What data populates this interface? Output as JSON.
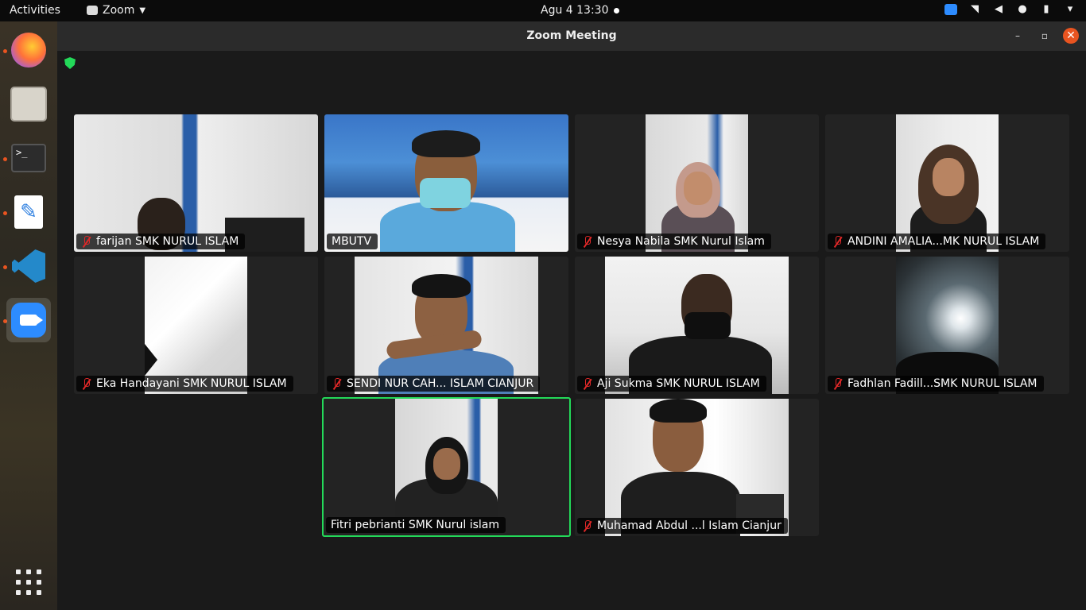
{
  "topbar": {
    "activities": "Activities",
    "app_name": "Zoom",
    "clock": "Agu 4  13:30"
  },
  "dock": {
    "items": [
      "firefox-icon",
      "files-icon",
      "terminal-icon",
      "text-editor-icon",
      "vscode-icon",
      "zoom-icon",
      "app-grid-icon"
    ],
    "terminal_prompt": ">_"
  },
  "window": {
    "title": "Zoom Meeting",
    "minimize": "–",
    "maximize": "▫",
    "close": "✕"
  },
  "participants": [
    {
      "name": "farijan SMK NURUL ISLAM",
      "muted": true
    },
    {
      "name": "MBUTV",
      "muted": false
    },
    {
      "name": "Nesya  Nabila SMK Nurul Islam",
      "muted": true
    },
    {
      "name": "ANDINI AMALIA...MK NURUL ISLAM",
      "muted": true
    },
    {
      "name": "Eka Handayani SMK NURUL ISLAM",
      "muted": true
    },
    {
      "name": "SENDI NUR CAH... ISLAM CIANJUR",
      "muted": true
    },
    {
      "name": "Aji Sukma SMK NURUL ISLAM",
      "muted": true
    },
    {
      "name": "Fadhlan Fadill...SMK NURUL ISLAM",
      "muted": true
    },
    {
      "name": "Fitri pebrianti SMK Nurul islam",
      "muted": false,
      "active_speaker": true
    },
    {
      "name": "Muhamad Abdul ...l Islam Cianjur",
      "muted": true
    }
  ],
  "colors": {
    "zoom_blue": "#2d8cff",
    "speaker_border": "#23d959",
    "mute_red": "#e02828",
    "ubuntu_orange": "#e95420"
  }
}
